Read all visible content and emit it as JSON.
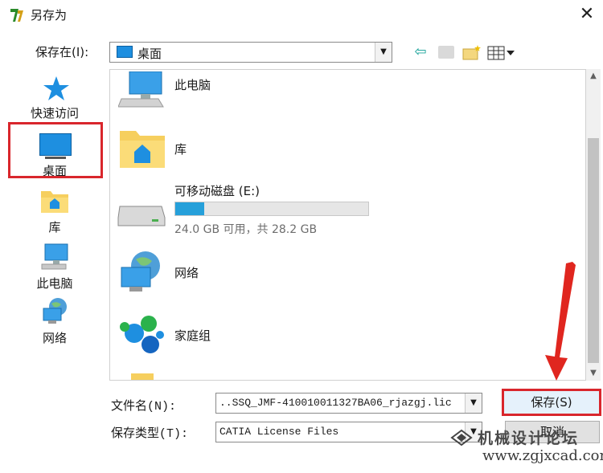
{
  "window": {
    "title": "另存为",
    "close_glyph": "✕"
  },
  "toolbar": {
    "save_in_label": "保存在(I):",
    "location": "桌面",
    "icons": [
      "back-arrow-icon",
      "up-folder-icon",
      "new-folder-icon",
      "views-menu-icon"
    ]
  },
  "places": [
    {
      "label": "快速访问",
      "icon": "star-icon"
    },
    {
      "label": "桌面",
      "icon": "desktop-icon",
      "selected": true
    },
    {
      "label": "库",
      "icon": "library-folder-icon"
    },
    {
      "label": "此电脑",
      "icon": "computer-icon"
    },
    {
      "label": "网络",
      "icon": "network-icon"
    }
  ],
  "file_list": {
    "items": [
      {
        "name": "此电脑",
        "icon": "computer-icon"
      },
      {
        "name": "库",
        "icon": "library-folder-icon"
      },
      {
        "name": "可移动磁盘 (E:)",
        "icon": "removable-drive-icon",
        "free_text": "24.0 GB 可用，共 28.2 GB",
        "used_fraction": 0.15
      },
      {
        "name": "网络",
        "icon": "network-icon"
      },
      {
        "name": "家庭组",
        "icon": "homegroup-icon"
      }
    ]
  },
  "bottom": {
    "filename_label": "文件名(N):",
    "filename_value": "..SSQ_JMF-410010011327BA06_rjazgj.lic",
    "filetype_label": "保存类型(T):",
    "filetype_value": "CATIA License Files",
    "save_button": "保存(S)",
    "cancel_button": "取消"
  },
  "watermark": {
    "text": "机械设计论坛",
    "url": "www.zgjxcad.com"
  },
  "colors": {
    "highlight_box": "#d9262c",
    "accent_blue": "#1e8fe0"
  }
}
